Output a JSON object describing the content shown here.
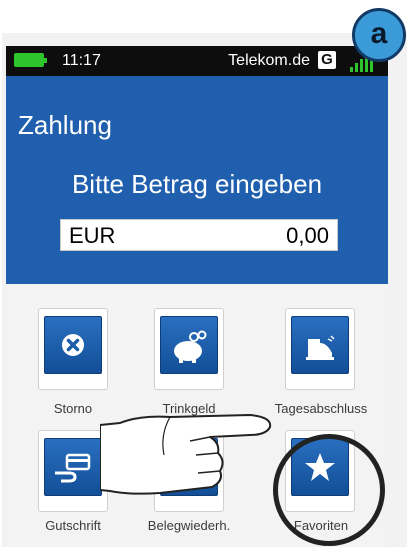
{
  "step_badge": "a",
  "status": {
    "time": "11:17",
    "carrier": "Telekom.de",
    "network_badge": "G"
  },
  "screen": {
    "title": "Zahlung",
    "prompt": "Bitte Betrag eingeben",
    "amount_field": {
      "currency": "EUR",
      "value": "0,00"
    }
  },
  "tiles": [
    {
      "label": "Storno",
      "icon": "cancel-icon"
    },
    {
      "label": "Trinkgeld",
      "icon": "piggy-bank-icon"
    },
    {
      "label": "Tagesabschluss",
      "icon": "cash-register-icon"
    },
    {
      "label": "Gutschrift",
      "icon": "card-refund-icon"
    },
    {
      "label": "Belegwiederh.",
      "icon": "receipt-icon"
    },
    {
      "label": "Favoriten",
      "icon": "star-icon"
    }
  ],
  "colors": {
    "header_blue": "#1f5fae",
    "battery_green": "#2ec42e",
    "badge_blue": "#3b9bd8"
  }
}
